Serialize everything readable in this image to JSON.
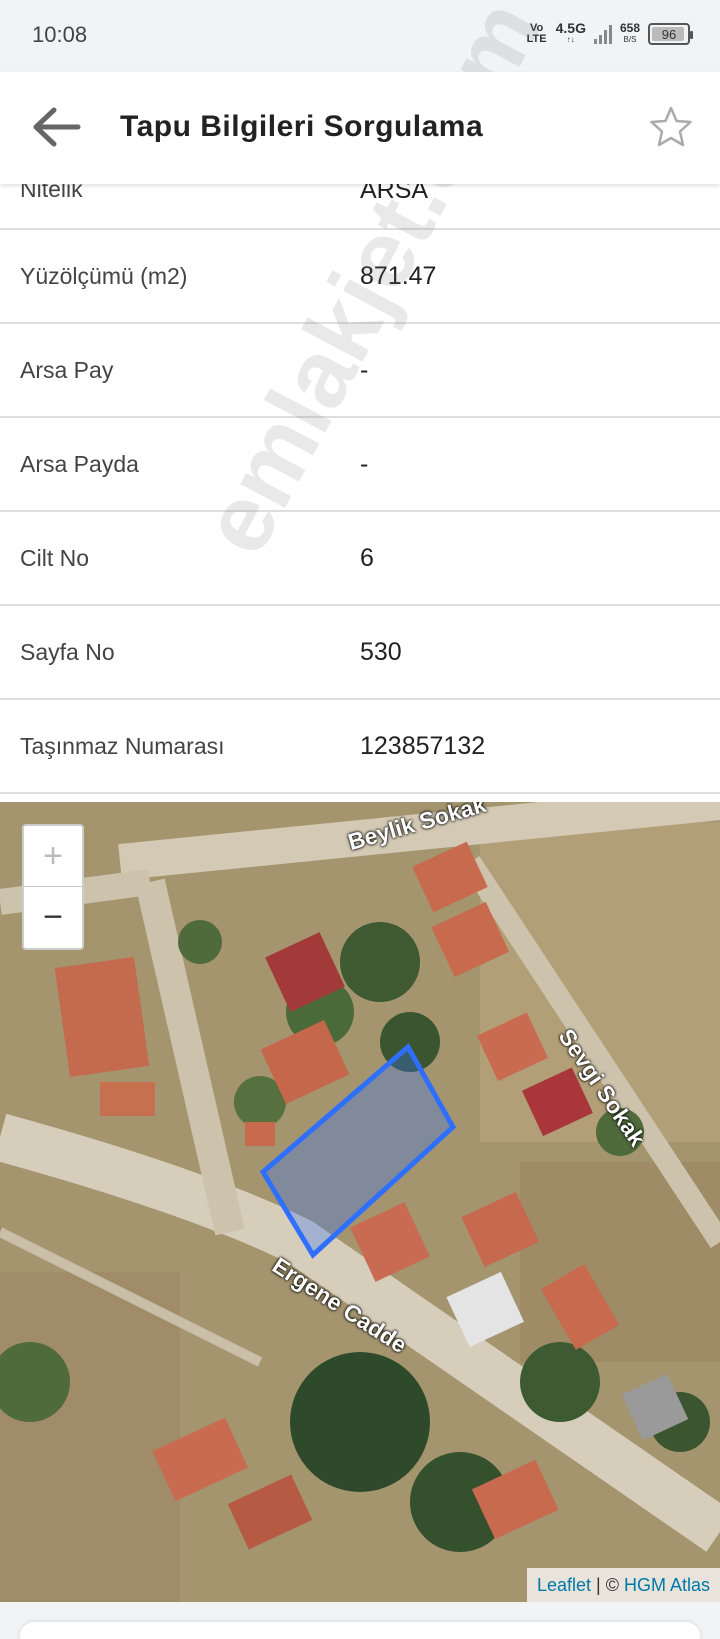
{
  "status_bar": {
    "time": "10:08",
    "volte_top": "Vo",
    "volte_bottom": "LTE",
    "network": "4.5G",
    "network_sub": "↑↓",
    "speed": "658",
    "speed_unit": "B/S",
    "battery": "96"
  },
  "header": {
    "title": "Tapu Bilgileri Sorgulama",
    "back_icon": "arrow-left-icon",
    "favorite_icon": "star-outline-icon"
  },
  "rows": [
    {
      "label": "Nitelik",
      "value": "ARSA"
    },
    {
      "label": "Yüzölçümü (m2)",
      "value": "871.47"
    },
    {
      "label": "Arsa Pay",
      "value": "-"
    },
    {
      "label": "Arsa Payda",
      "value": "-"
    },
    {
      "label": "Cilt No",
      "value": "6"
    },
    {
      "label": "Sayfa No",
      "value": "530"
    },
    {
      "label": "Taşınmaz Numarası",
      "value": "123857132"
    }
  ],
  "watermark": "emlakjet.com",
  "map": {
    "zoom_in": "+",
    "zoom_out": "−",
    "streets": {
      "beylik": "Beylik Sokak",
      "sevgi": "Sevgi Sokak",
      "ergene": "Ergene Cadde"
    },
    "attribution": {
      "leaflet": "Leaflet",
      "separator": " | © ",
      "provider": "HGM Atlas"
    },
    "parcel_color": "#2f6fff"
  }
}
